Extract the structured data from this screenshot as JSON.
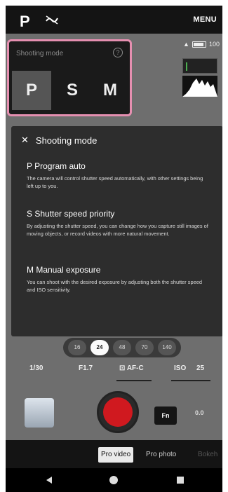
{
  "top_bar": {
    "mode": "P",
    "flash_icon": "flash-off-icon",
    "menu_label": "MENU"
  },
  "status": {
    "battery_text": "100",
    "card_icon": "storage-icon"
  },
  "shooting_mode": {
    "title": "Shooting mode",
    "options": [
      "P",
      "S",
      "M"
    ],
    "selected": "P"
  },
  "info_panel": {
    "title": "Shooting mode",
    "items": [
      {
        "title": "P Program auto",
        "desc": "The camera will control shutter speed automatically, with other settings being left up to you."
      },
      {
        "title": "S Shutter speed priority",
        "desc": "By adjusting the shutter speed, you can change how you capture still images of moving objects, or record videos with more natural movement."
      },
      {
        "title": "M Manual exposure",
        "desc": "You can shoot with the desired exposure by adjusting both the shutter speed and ISO sensitivity."
      }
    ]
  },
  "lens_chips": [
    "16",
    "24",
    "48",
    "70",
    "140"
  ],
  "lens_selected": "24",
  "params": {
    "shutter": "1/30",
    "aperture": "F1.7",
    "af": "AF-C",
    "iso_label": "ISO",
    "iso_value": "25"
  },
  "controls": {
    "fn_label": "Fn",
    "ev_label": "0.0"
  },
  "tabs": {
    "items": [
      "Pro video",
      "Pro photo",
      "Bokeh"
    ],
    "active": "Pro video"
  },
  "colors": {
    "highlight": "#e58fb0",
    "shutter": "#d0191f"
  }
}
